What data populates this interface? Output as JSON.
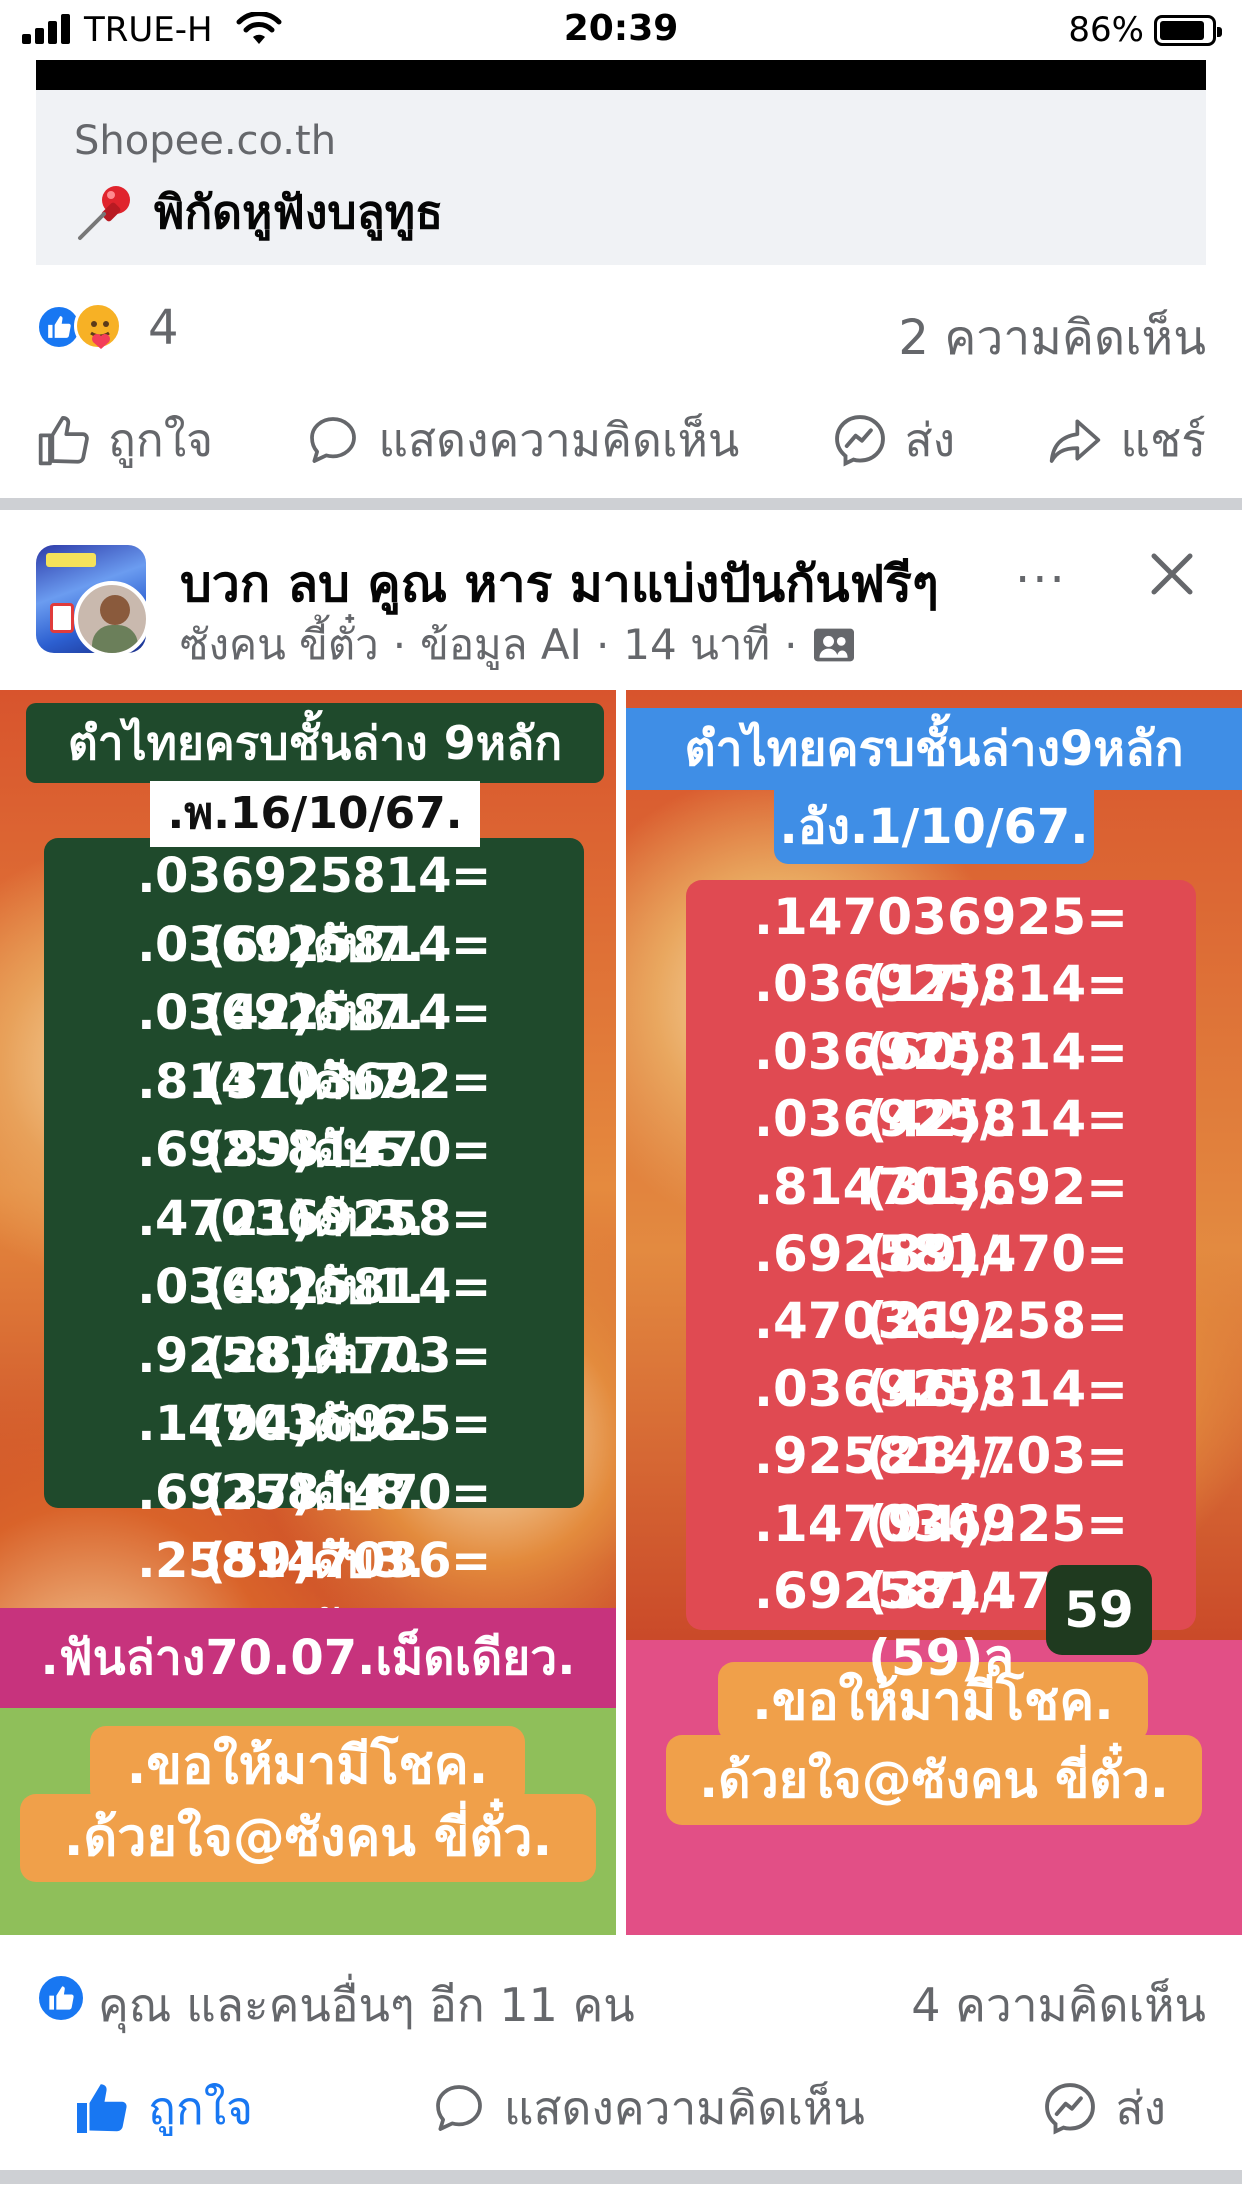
{
  "status_bar": {
    "carrier": "TRUE-H",
    "time": "20:39",
    "battery_percent": "86%",
    "battery_level": 0.86
  },
  "prev_post": {
    "link_domain": "Shopee.co.th",
    "link_title": "พิกัดหูฟังบลูทูธ",
    "reaction_count": "4",
    "comment_count": "2 ความคิดเห็น",
    "actions": {
      "like": "ถูกใจ",
      "comment": "แสดงความคิดเห็น",
      "send": "ส่ง",
      "share": "แชร์"
    }
  },
  "post": {
    "title": "บวก ลบ คูณ หาร มาแบ่งปันกันฟรีๆ",
    "author": "ซังคน ขี้ตั๋ว",
    "ai_info": "ข้อมูล AI",
    "time": "14 นาที",
    "more_label": "···",
    "left_image": {
      "heading": "ตำไทยครบชั้นล่าง 9หลัก",
      "date": ".พ.16/10/67.",
      "rows": [
        ".036925814=(60)ดับ7.",
        ".036925814=(42)ดับ7.",
        ".036925814=(31)ดับ7.",
        ".814703692=(89)ดับ5.",
        ".692581470=(21)ดับ3.",
        ".470369258=(46)ดับ1.",
        ".036925814=(28)ดับ7.",
        ".925814703=(94)ดับ6.",
        ".147036925=(37)ดับ8.",
        ".692581470=(59)ดับ3.",
        ".258147036=(??)ดับ9."
      ],
      "bottom_banner": ".ฟันล่าง70.07.เม็ดเดียว.",
      "blessing_1": ".ขอให้มามีโชค.",
      "blessing_2": ".ด้วยใจ@ซังคน ขี่ตั๋ว."
    },
    "right_image": {
      "heading": "ตำไทยครบชั้นล่าง9หลัก",
      "date": ".อัง.1/10/67.",
      "rows": [
        ".147036925=(17)/.",
        ".036925814=(60)/.",
        ".036925814=(42)/.",
        ".036925814=(31)/.",
        ".814703692=(89)/.",
        ".692581470=(21)/.",
        ".470369258=(46)/.",
        ".036925814=(28)/.",
        ".925814703=(94)/.",
        ".147036925=(37)/.",
        ".692581470=(59)ล"
      ],
      "badge": "59",
      "blessing_1": ".ขอให้มามีโชค.",
      "blessing_2": ".ด้วยใจ@ซังคน ขี่ตั๋ว."
    },
    "reaction_text": "คุณ และคนอื่นๆ อีก 11 คน",
    "comment_count": "4 ความคิดเห็น",
    "actions": {
      "like": "ถูกใจ",
      "comment": "แสดงความคิดเห็น",
      "send": "ส่ง"
    }
  }
}
